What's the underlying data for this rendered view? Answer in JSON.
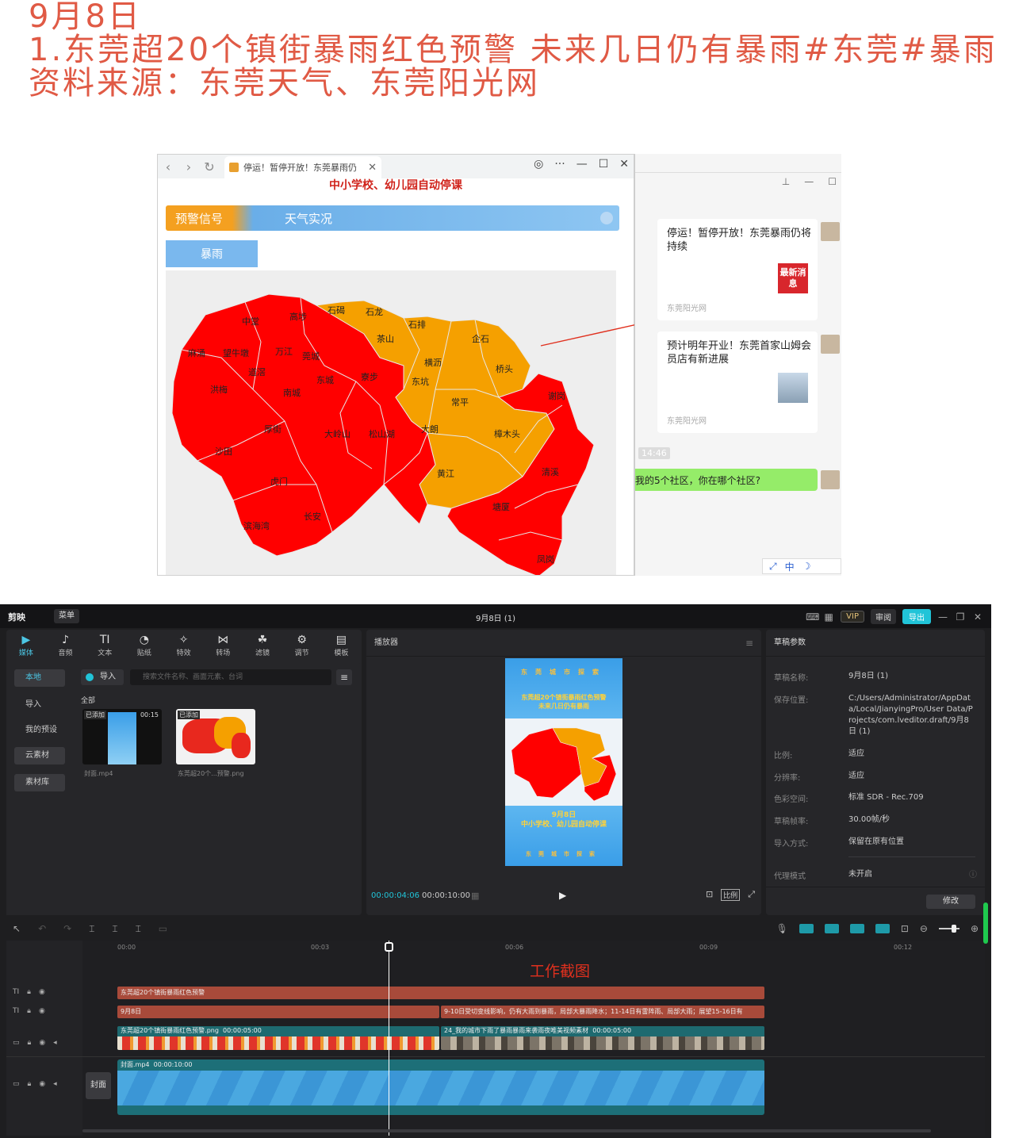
{
  "heading": {
    "line1": "9月8日",
    "line2": "1.东莞超20个镇街暴雨红色预警 未来几日仍有暴雨#东莞#暴雨",
    "line3": "资料来源：东莞天气、东莞阳光网"
  },
  "browser": {
    "tab_title": "停运！暂停开放！东莞暴雨仍",
    "page_notice": "中小学校、幼儿园自动停课",
    "tab_warning": "预警信号",
    "tab_weather": "天气实况",
    "rain_button": "暴雨",
    "map": {
      "colors": {
        "red": "#ff0000",
        "orange": "#f5a000"
      },
      "labels": [
        {
          "name": "中堂",
          "level": "red"
        },
        {
          "name": "高埗",
          "level": "red"
        },
        {
          "name": "石碣",
          "level": "orange"
        },
        {
          "name": "石龙",
          "level": "orange"
        },
        {
          "name": "石排",
          "level": "orange"
        },
        {
          "name": "茶山",
          "level": "orange"
        },
        {
          "name": "企石",
          "level": "orange"
        },
        {
          "name": "麻涌",
          "level": "red"
        },
        {
          "name": "望牛墩",
          "level": "red"
        },
        {
          "name": "万江",
          "level": "red"
        },
        {
          "name": "莞城",
          "level": "red"
        },
        {
          "name": "横沥",
          "level": "orange"
        },
        {
          "name": "桥头",
          "level": "orange"
        },
        {
          "name": "洪梅",
          "level": "red"
        },
        {
          "name": "道滘",
          "level": "red"
        },
        {
          "name": "东城",
          "level": "red"
        },
        {
          "name": "寮步",
          "level": "red"
        },
        {
          "name": "东坑",
          "level": "orange"
        },
        {
          "name": "谢岗",
          "level": "red"
        },
        {
          "name": "南城",
          "level": "red"
        },
        {
          "name": "常平",
          "level": "orange"
        },
        {
          "name": "厚街",
          "level": "red"
        },
        {
          "name": "大岭山",
          "level": "red"
        },
        {
          "name": "松山湖",
          "level": "red"
        },
        {
          "name": "大朗",
          "level": "red"
        },
        {
          "name": "樟木头",
          "level": "orange"
        },
        {
          "name": "沙田",
          "level": "red"
        },
        {
          "name": "黄江",
          "level": "orange"
        },
        {
          "name": "清溪",
          "level": "red"
        },
        {
          "name": "虎门",
          "level": "red"
        },
        {
          "name": "塘厦",
          "level": "red"
        },
        {
          "name": "长安",
          "level": "red"
        },
        {
          "name": "滨海湾",
          "level": "red"
        },
        {
          "name": "凤岗",
          "level": "red"
        }
      ]
    }
  },
  "chat": {
    "card1_text": "停运！暂停开放！东莞暴雨仍将持续",
    "card1_badge": "最新消息",
    "card1_source": "东莞阳光网",
    "card2_text": "预计明年开业！东莞首家山姆会员店有新进展",
    "card2_source": "东莞阳光网",
    "time": "14:46",
    "green_message": "我的5个社区，你在哪个社区?",
    "ime_label": "中"
  },
  "editor": {
    "app_name": "剪映",
    "menu": "菜单",
    "title": "9月8日 (1)",
    "vip": "VIP",
    "review": "审阅",
    "export": "导出",
    "tools": [
      {
        "label": "媒体",
        "icon": "media-icon"
      },
      {
        "label": "音频",
        "icon": "audio-icon"
      },
      {
        "label": "文本",
        "icon": "text-icon"
      },
      {
        "label": "贴纸",
        "icon": "sticker-icon"
      },
      {
        "label": "特效",
        "icon": "effect-icon"
      },
      {
        "label": "转场",
        "icon": "transition-icon"
      },
      {
        "label": "滤镜",
        "icon": "filter-icon"
      },
      {
        "label": "调节",
        "icon": "adjust-icon"
      },
      {
        "label": "模板",
        "icon": "template-icon"
      }
    ],
    "side_nav": [
      "本地",
      "导入",
      "我的预设",
      "云素材",
      "素材库"
    ],
    "import_button": "导入",
    "search_placeholder": "搜索文件名称、画面元素、台词",
    "all_label": "全部",
    "media_items": [
      {
        "badge": "已添加",
        "duration": "00:15",
        "name": "封面.mp4"
      },
      {
        "badge": "已添加",
        "name": "东莞超20个...预警.png"
      }
    ],
    "player": {
      "header": "播放器",
      "pv_top": "东莞城市探索",
      "pv_title_1": "东莞超20个镇街暴雨红色预警",
      "pv_title_2": "未来几日仍有暴雨",
      "pv_date": "9月8日",
      "pv_notice": "中小学校、幼儿园自动停课",
      "pv_bottom": "东莞城市探索",
      "current_time": "00:00:04:06",
      "total_time": "00:00:10:00",
      "ratio": "比例"
    },
    "props": {
      "header": "草稿参数",
      "rows": [
        {
          "label": "草稿名称:",
          "value": "9月8日 (1)"
        },
        {
          "label": "保存位置:",
          "value": "C:/Users/Administrator/AppData/Local/JianyingPro/User Data/Projects/com.lveditor.draft/9月8日 (1)"
        },
        {
          "label": "比例:",
          "value": "适应"
        },
        {
          "label": "分辨率:",
          "value": "适应"
        },
        {
          "label": "色彩空间:",
          "value": "标准 SDR - Rec.709"
        },
        {
          "label": "草稿帧率:",
          "value": "30.00帧/秒"
        },
        {
          "label": "导入方式:",
          "value": "保留在原有位置"
        },
        {
          "label": "代理模式",
          "value": "未开启"
        }
      ],
      "modify_button": "修改"
    },
    "timeline": {
      "ruler": [
        "00:00",
        "00:03",
        "00:06",
        "00:09",
        "00:12"
      ],
      "caption": "工作截图",
      "clips": {
        "text1": "东莞超20个镇街暴雨红色预警",
        "text2a": "9月8日",
        "text2b": "9-10日受切变线影响，仍有大雨到暴雨，局部大暴雨降水；11-14日有雷阵雨、局部大雨；展望15-16日有",
        "img1": "东莞超20个镇街暴雨红色预警.png",
        "img1_dur": "00:00:05:00",
        "img2": "24_我的城市下雨了暴雨暴雨来袭雨夜唯美视频素材",
        "img2_dur": "00:00:05:00",
        "video": "封面.mp4",
        "video_dur": "00:00:10:00",
        "cover": "封面"
      }
    }
  }
}
